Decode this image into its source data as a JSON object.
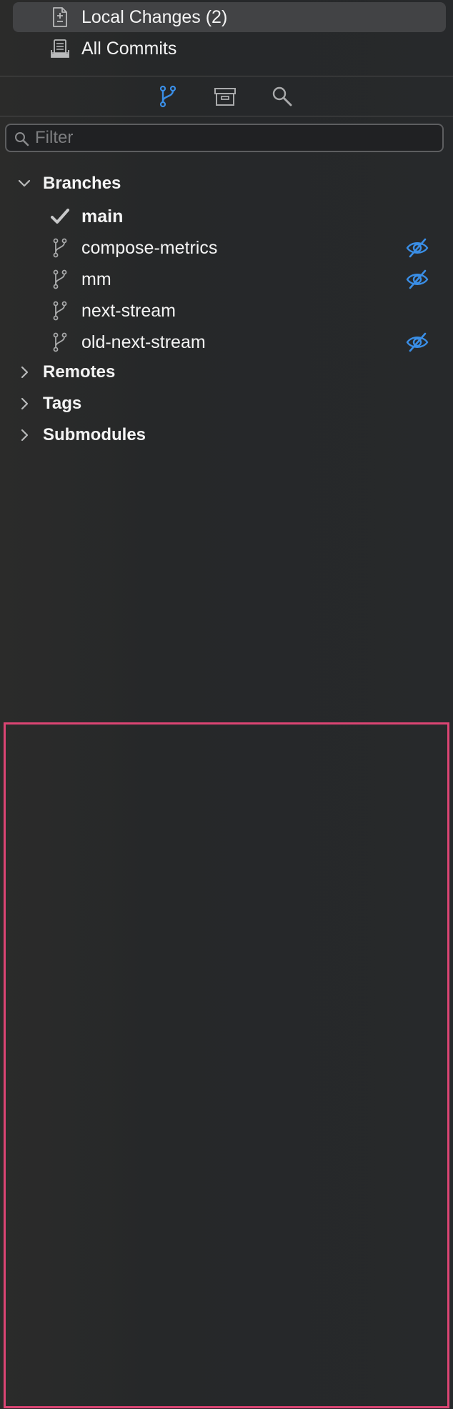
{
  "nav": {
    "items": [
      {
        "label": "Local Changes (2)",
        "icon": "local-changes-icon",
        "selected": true
      },
      {
        "label": "All Commits",
        "icon": "all-commits-icon",
        "selected": false
      }
    ]
  },
  "toolbar": {
    "buttons": [
      {
        "icon": "branch-icon",
        "active": true
      },
      {
        "icon": "archive-icon",
        "active": false
      },
      {
        "icon": "search-icon",
        "active": false
      }
    ]
  },
  "filter": {
    "placeholder": "Filter",
    "value": ""
  },
  "sections": {
    "branches": {
      "label": "Branches",
      "expanded": true
    },
    "remotes": {
      "label": "Remotes",
      "expanded": false
    },
    "tags": {
      "label": "Tags",
      "expanded": false
    },
    "submodules": {
      "label": "Submodules",
      "expanded": false
    }
  },
  "branches": [
    {
      "name": "main",
      "current": true,
      "hidden": false
    },
    {
      "name": "compose-metrics",
      "current": false,
      "hidden": true
    },
    {
      "name": "mm",
      "current": false,
      "hidden": true
    },
    {
      "name": "next-stream",
      "current": false,
      "hidden": false
    },
    {
      "name": "old-next-stream",
      "current": false,
      "hidden": true
    }
  ],
  "colors": {
    "accent": "#3a8ee6",
    "selection": "#424345",
    "highlight_border": "#dc4574",
    "text": "#f4f4f4",
    "icon_gray": "#a9aaab"
  }
}
